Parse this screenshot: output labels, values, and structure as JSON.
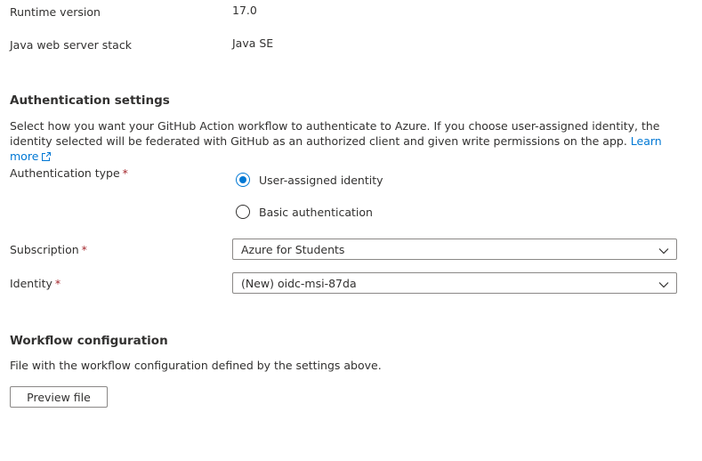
{
  "runtime": {
    "label": "Runtime version",
    "value": "17.0"
  },
  "server_stack": {
    "label": "Java web server stack",
    "value": "Java SE"
  },
  "auth_settings": {
    "title": "Authentication settings",
    "description": "Select how you want your GitHub Action workflow to authenticate to Azure. If you choose user-assigned identity, the identity selected will be federated with GitHub as an authorized client and given write permissions on the app.",
    "learn_more": "Learn more",
    "auth_type": {
      "label": "Authentication type",
      "required_mark": "*",
      "options": [
        {
          "label": "User-assigned identity",
          "checked": true
        },
        {
          "label": "Basic authentication",
          "checked": false
        }
      ]
    },
    "subscription": {
      "label": "Subscription",
      "required_mark": "*",
      "value": "Azure for Students"
    },
    "identity": {
      "label": "Identity",
      "required_mark": "*",
      "value": "(New) oidc-msi-87da"
    }
  },
  "workflow": {
    "title": "Workflow configuration",
    "description": "File with the workflow configuration defined by the settings above.",
    "preview_button": "Preview file"
  },
  "colors": {
    "accent": "#0078d4",
    "required": "#a4262c",
    "text": "#323130",
    "border": "#8a8886"
  },
  "icons": {
    "external_link": "external-link-icon",
    "dropdown": "chevron-down-icon"
  }
}
